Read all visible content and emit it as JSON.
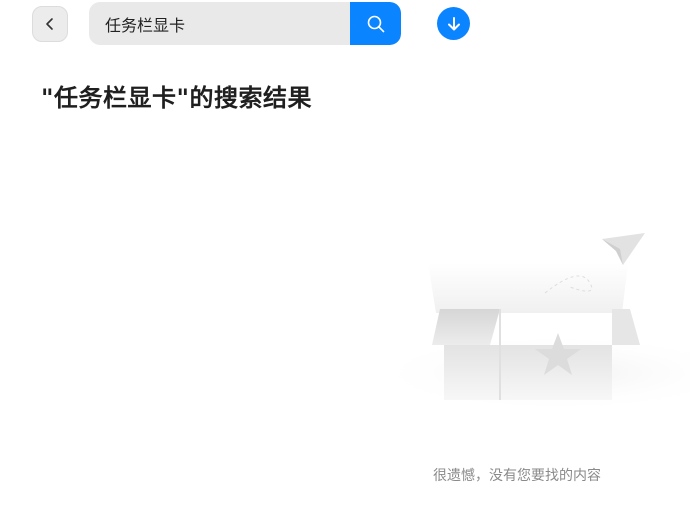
{
  "header": {
    "search_value": "任务栏显卡",
    "back_icon": "chevron-left-icon",
    "search_icon": "search-icon",
    "download_icon": "download-icon",
    "accent_color": "#0a84ff"
  },
  "results": {
    "title": "\"任务栏显卡\"的搜索结果",
    "empty_message": "很遗憾，没有您要找的内容",
    "empty_illustration": "empty-box-illustration"
  }
}
